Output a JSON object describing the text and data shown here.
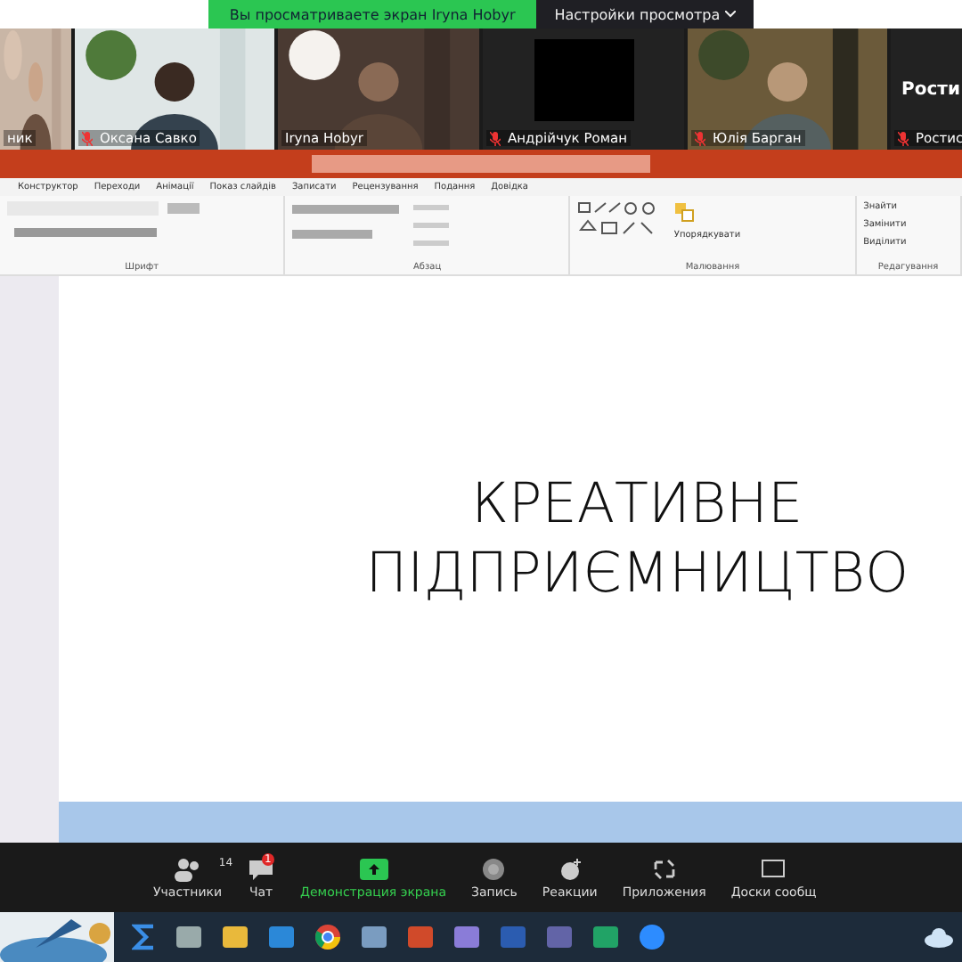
{
  "share_banner": {
    "message": "Вы просматриваете экран Iryna Hobyr",
    "view_options": "Настройки просмотра"
  },
  "participants": [
    {
      "name": "ник",
      "kind": "video",
      "muted": false
    },
    {
      "name": "Оксана Савко",
      "kind": "video",
      "muted": true
    },
    {
      "name": "Iryna Hobyr",
      "kind": "video",
      "muted": false
    },
    {
      "name": "Андрійчук Роман",
      "kind": "dark",
      "muted": true
    },
    {
      "name": "Юлія Барган",
      "kind": "video",
      "muted": true
    },
    {
      "name": "Ростис",
      "kind": "name",
      "display": "Рости",
      "muted": true
    }
  ],
  "ribbon": {
    "tabs": [
      "Конструктор",
      "Переходи",
      "Анімації",
      "Показ слайдів",
      "Записати",
      "Рецензування",
      "Подання",
      "Довідка"
    ],
    "groups": [
      "Шрифт",
      "Абзац",
      "Малювання",
      "Редагування"
    ],
    "arrange": "Упорядкувати",
    "editing": [
      "Знайти",
      "Замінити",
      "Виділити"
    ]
  },
  "slide": {
    "title_lines": [
      "КРЕАТИВНЕ",
      "ПІДПРИЄМНИЦТВО"
    ]
  },
  "toolbar": [
    {
      "kind": "participants",
      "label": "Участники",
      "count": "14",
      "selected": false
    },
    {
      "kind": "chat",
      "label": "Чат",
      "badge": "1",
      "selected": false
    },
    {
      "kind": "share",
      "label": "Демонстрация экрана",
      "selected": true
    },
    {
      "kind": "record",
      "label": "Запись",
      "selected": false
    },
    {
      "kind": "reactions",
      "label": "Реакции",
      "selected": false
    },
    {
      "kind": "apps",
      "label": "Приложения",
      "selected": false
    },
    {
      "kind": "board",
      "label": "Доски сообщ",
      "selected": false
    }
  ]
}
